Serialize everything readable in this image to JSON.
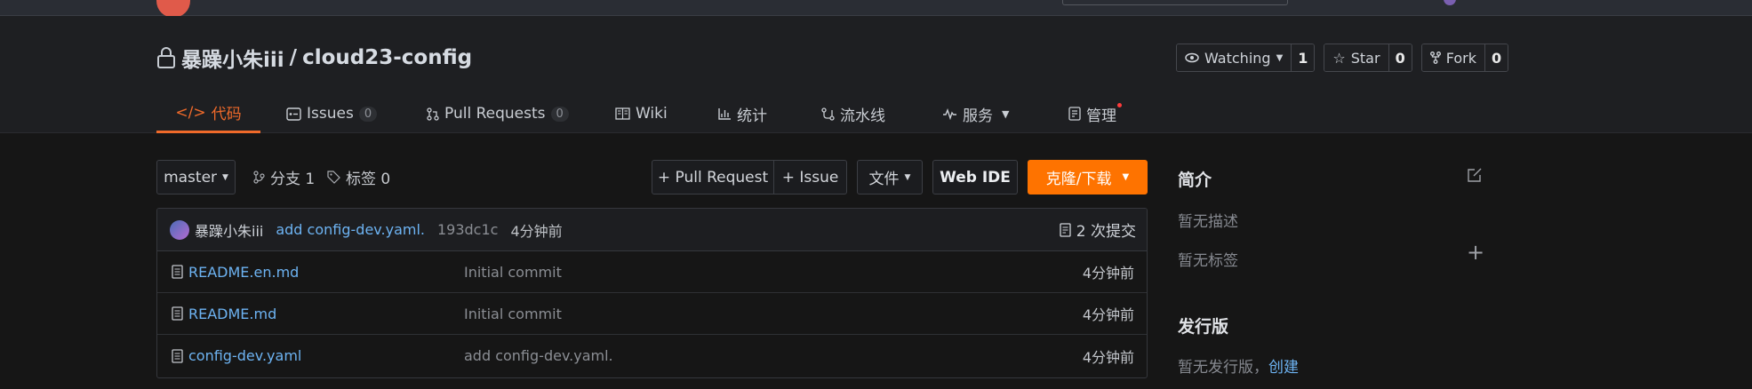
{
  "repo": {
    "owner": "暴躁小朱iii",
    "separator": " / ",
    "name": "cloud23-config"
  },
  "actions": {
    "watch_label": "Watching",
    "watch_count": "1",
    "star_label": "Star",
    "star_count": "0",
    "fork_label": "Fork",
    "fork_count": "0"
  },
  "tabs": [
    {
      "label": "代码"
    },
    {
      "label": "Issues",
      "count": "0"
    },
    {
      "label": "Pull Requests",
      "count": "0"
    },
    {
      "label": "Wiki"
    },
    {
      "label": "统计"
    },
    {
      "label": "流水线"
    },
    {
      "label": "服务"
    },
    {
      "label": "管理"
    }
  ],
  "toolbar": {
    "branch": "master",
    "branches_label": "分支 1",
    "tags_label": "标签 0",
    "pull_request": "+ Pull Request",
    "issue": "+ Issue",
    "file": "文件",
    "web_ide": "Web IDE",
    "clone": "克隆/下载"
  },
  "commit": {
    "author": "暴躁小朱iii",
    "message": "add config-dev.yaml.",
    "sha": "193dc1c",
    "time": "4分钟前",
    "commits_label": "2 次提交"
  },
  "files": [
    {
      "name": "README.en.md",
      "message": "Initial commit",
      "time": "4分钟前"
    },
    {
      "name": "README.md",
      "message": "Initial commit",
      "time": "4分钟前"
    },
    {
      "name": "config-dev.yaml",
      "message": "add config-dev.yaml.",
      "time": "4分钟前"
    }
  ],
  "sidebar": {
    "intro_title": "简介",
    "no_desc": "暂无描述",
    "no_tags": "暂无标签",
    "release_title": "发行版",
    "no_release": "暂无发行版，",
    "create_link": "创建"
  },
  "colors": {
    "accent": "#fe7300",
    "link": "#6db3f2",
    "active_tab": "#f06a2a"
  }
}
